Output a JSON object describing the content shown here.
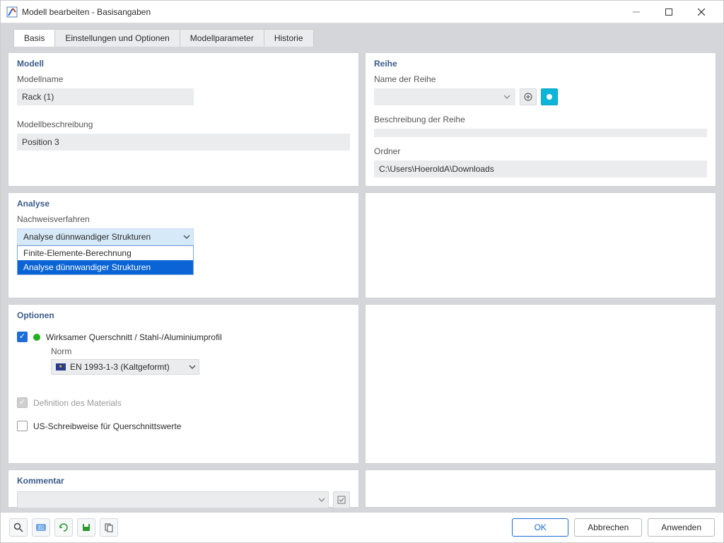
{
  "window": {
    "title": "Modell bearbeiten - Basisangaben"
  },
  "tabs": [
    {
      "label": "Basis",
      "active": true
    },
    {
      "label": "Einstellungen und Optionen"
    },
    {
      "label": "Modellparameter"
    },
    {
      "label": "Historie"
    }
  ],
  "groups": {
    "modell": {
      "title": "Modell",
      "name_label": "Modellname",
      "name_value": "Rack (1)",
      "desc_label": "Modellbeschreibung",
      "desc_value": "Position 3"
    },
    "reihe": {
      "title": "Reihe",
      "name_label": "Name der Reihe",
      "name_value": "",
      "desc_label": "Beschreibung der Reihe",
      "desc_value": "",
      "folder_label": "Ordner",
      "folder_value": "C:\\Users\\HoeroldA\\Downloads"
    },
    "analyse": {
      "title": "Analyse",
      "proc_label": "Nachweisverfahren",
      "proc_value": "Analyse dünnwandiger Strukturen",
      "options": [
        "Finite-Elemente-Berechnung",
        "Analyse dünnwandiger Strukturen"
      ],
      "highlighted_index": 1
    },
    "optionen": {
      "title": "Optionen",
      "eff_label": "Wirksamer Querschnitt / Stahl-/Aluminiumprofil",
      "norm_label": "Norm",
      "norm_value": "EN 1993-1-3 (Kaltgeformt)",
      "mat_label": "Definition des Materials",
      "us_label": "US-Schreibweise für Querschnittswerte"
    },
    "kommentar": {
      "title": "Kommentar"
    }
  },
  "footer": {
    "ok": "OK",
    "cancel": "Abbrechen",
    "apply": "Anwenden"
  }
}
